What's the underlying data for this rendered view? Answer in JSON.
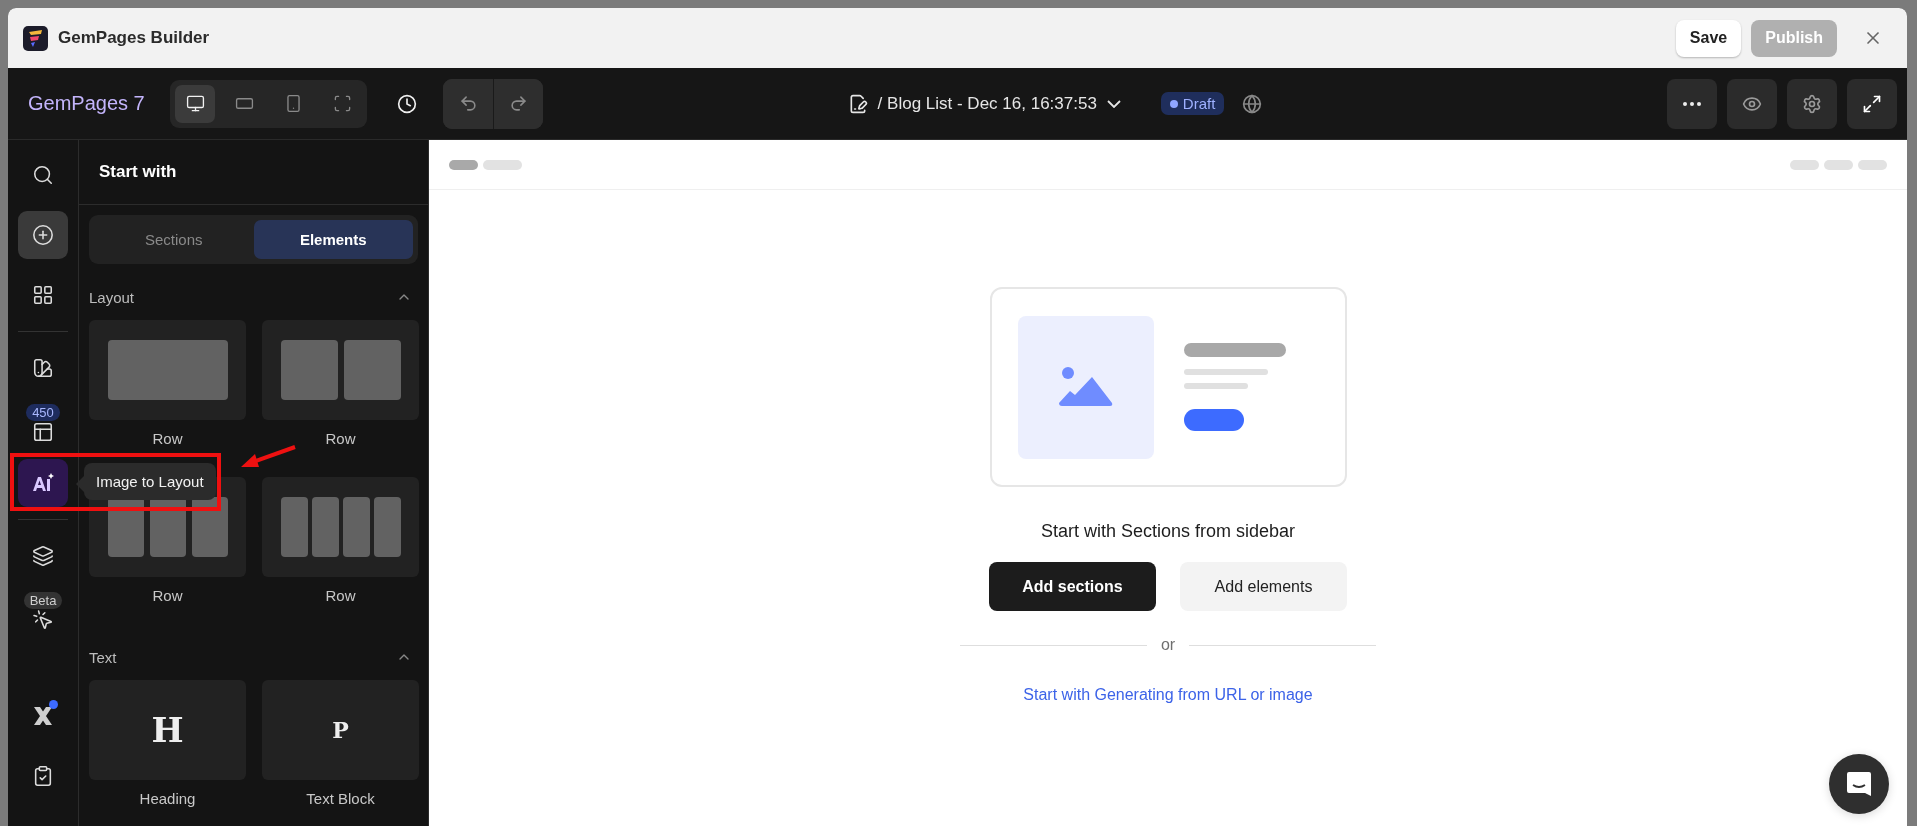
{
  "window": {
    "title": "GemPages Builder",
    "buttons": [
      {
        "label": "Save",
        "disabled": false
      },
      {
        "label": "Publish",
        "disabled": true
      }
    ]
  },
  "toolbar": {
    "brand": "GemPages 7",
    "devices": [
      {
        "kind": "desktop",
        "selected": true
      },
      {
        "kind": "tablet",
        "selected": false
      },
      {
        "kind": "mobile",
        "selected": false
      },
      {
        "kind": "fullwidth",
        "selected": false
      }
    ],
    "page_title": "/ Blog List - Dec 16, 16:37:53",
    "status": "Draft"
  },
  "rail": {
    "groups": [
      [
        {
          "kind": "search",
          "selected": false
        },
        {
          "kind": "add",
          "selected": true
        },
        {
          "kind": "apps",
          "selected": false
        }
      ],
      [
        {
          "kind": "theme",
          "selected": false
        },
        {
          "kind": "templates",
          "selected": false,
          "badge": "450"
        },
        {
          "kind": "ai",
          "selected": false,
          "highlighted": true,
          "tooltip": "Image to Layout"
        }
      ],
      [
        {
          "kind": "layers",
          "selected": false
        },
        {
          "kind": "cursor",
          "selected": false,
          "badge": "Beta"
        }
      ]
    ],
    "bottom": [
      {
        "kind": "logo",
        "selected": false,
        "notification": true
      },
      {
        "kind": "checklist",
        "selected": false
      }
    ]
  },
  "panel": {
    "title": "Start with",
    "tabs": [
      {
        "label": "Sections",
        "selected": false
      },
      {
        "label": "Elements",
        "selected": true
      }
    ],
    "groups": [
      {
        "title": "Layout",
        "expanded": true,
        "items": [
          {
            "kind": "single",
            "label": "Row"
          },
          {
            "kind": "double",
            "label": "Row"
          },
          {
            "kind": "triple",
            "label": "Row"
          },
          {
            "kind": "quad",
            "label": "Row"
          }
        ]
      },
      {
        "title": "Text",
        "expanded": true,
        "items": [
          {
            "kind": "heading",
            "glyph": "H",
            "label": "Heading"
          },
          {
            "kind": "paragraph",
            "glyph": "P",
            "label": "Text Block"
          }
        ]
      }
    ]
  },
  "canvas": {
    "prompt": "Start with Sections from sidebar",
    "buttons": [
      {
        "label": "Add sections",
        "kind": "primary"
      },
      {
        "label": "Add elements",
        "kind": "secondary"
      }
    ],
    "divider": "or",
    "link": "Start with Generating from URL or image"
  }
}
